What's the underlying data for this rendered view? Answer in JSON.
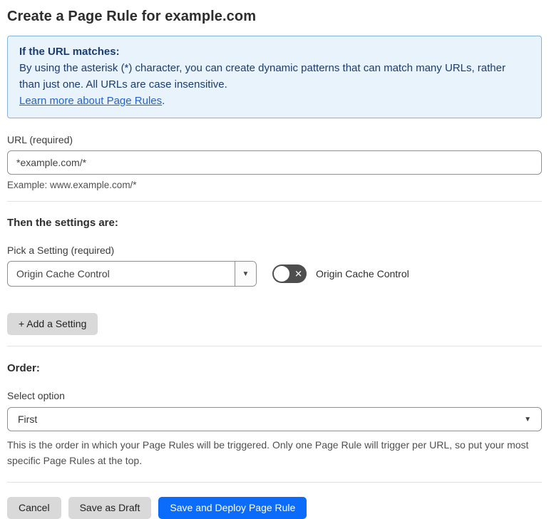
{
  "page": {
    "title": "Create a Page Rule for example.com"
  },
  "info_box": {
    "heading": "If the URL matches:",
    "body": "By using the asterisk (*) character, you can create dynamic patterns that can match many URLs, rather than just one. All URLs are case insensitive.",
    "link_label": "Learn more about Page Rules",
    "link_suffix": "."
  },
  "url_field": {
    "label": "URL (required)",
    "value": "*example.com/*",
    "helper": "Example: www.example.com/*"
  },
  "settings_section": {
    "heading": "Then the settings are:",
    "picker_label": "Pick a Setting (required)",
    "selected_setting": "Origin Cache Control",
    "toggle_label": "Origin Cache Control",
    "toggle_state": "off",
    "add_setting_label": "+ Add a Setting"
  },
  "order_section": {
    "heading": "Order:",
    "select_label": "Select option",
    "selected_option": "First",
    "help_text": "This is the order in which your Page Rules will be triggered. Only one Page Rule will trigger per URL, so put your most specific Page Rules at the top."
  },
  "footer": {
    "cancel_label": "Cancel",
    "save_draft_label": "Save as Draft",
    "save_deploy_label": "Save and Deploy Page Rule"
  },
  "icons": {
    "dropdown_arrow": "▼",
    "toggle_off": "✕"
  },
  "colors": {
    "info_bg": "#e9f3fc",
    "info_border": "#86b1e3",
    "info_text": "#1b3c6e",
    "link": "#2263cf",
    "primary_button": "#0b6bfb",
    "secondary_button": "#d9d9d9",
    "toggle_off_bg": "#4e4e4e"
  }
}
